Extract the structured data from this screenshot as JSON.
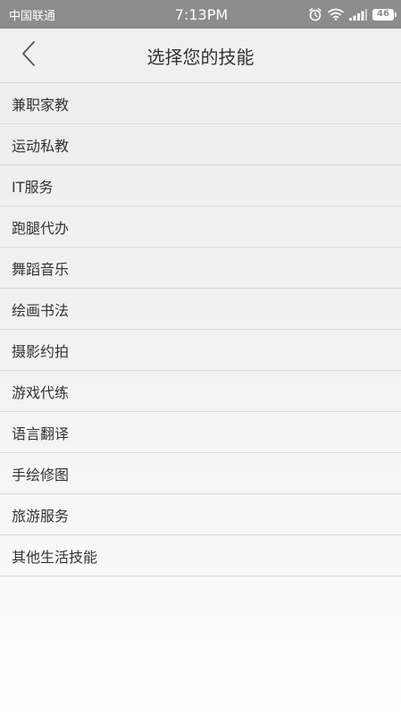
{
  "status_bar": {
    "carrier": "中国联通",
    "time": "7:13PM",
    "battery": "46",
    "icons": [
      "alarm-icon",
      "wifi-icon",
      "signal-icon",
      "battery-icon"
    ]
  },
  "header": {
    "back_icon": "chevron-left-icon",
    "title": "选择您的技能"
  },
  "skills": [
    "兼职家教",
    "运动私教",
    "IT服务",
    "跑腿代办",
    "舞蹈音乐",
    "绘画书法",
    "摄影约拍",
    "游戏代练",
    "语言翻译",
    "手绘修图",
    "旅游服务",
    "其他生活技能"
  ],
  "colors": {
    "status_bar": "#8c8c8c",
    "background": "#f0f0f0",
    "divider": "#d9d9d9",
    "text": "#333333"
  }
}
